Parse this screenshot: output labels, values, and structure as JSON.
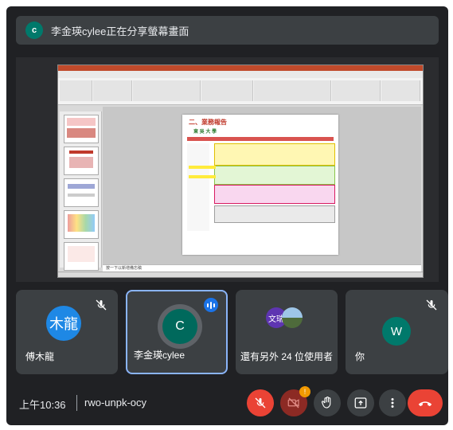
{
  "banner": {
    "avatar_initial": "c",
    "text": "李金瑛cylee正在分享螢幕畫面"
  },
  "shared_slide": {
    "slide_title": "二、業務報告",
    "university": "東 吳 大 學",
    "notes_placeholder": "按一下以新增備忘稿"
  },
  "tiles": [
    {
      "name": "傅木龍",
      "avatar_text": "木龍",
      "avatar_color": "#1e88e5",
      "muted": true
    },
    {
      "name": "李金瑛cylee",
      "avatar_text": "C",
      "avatar_color": "#00695c",
      "speaking": true
    },
    {
      "label": "還有另外 24 位使用者",
      "avatar_text": "文瑞",
      "avatar_color": "#5e35b1"
    },
    {
      "name": "你",
      "avatar_text": "W",
      "avatar_color": "#00796b",
      "muted": true
    }
  ],
  "bottom": {
    "time": "上午10:36",
    "meeting_code": "rwo-unpk-ocy",
    "camera_badge": "!"
  },
  "colors": {
    "accent": "#8ab4f8",
    "danger": "#ea4335",
    "surface": "#3c4043",
    "background": "#202124"
  }
}
